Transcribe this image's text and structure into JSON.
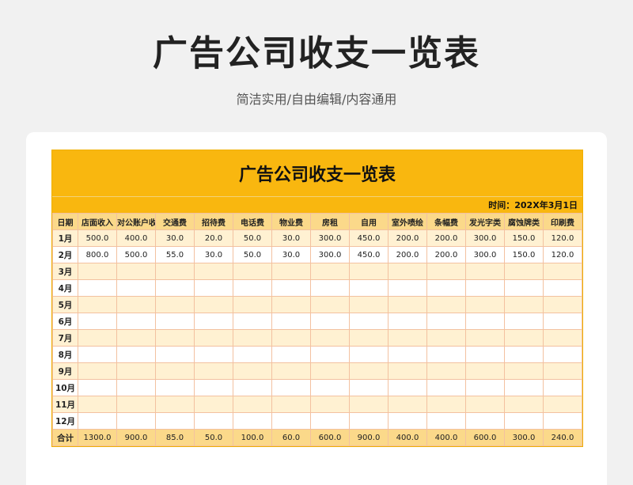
{
  "header": {
    "title": "广告公司收支一览表",
    "subtitle": "简洁实用/自由编辑/内容通用"
  },
  "sheet": {
    "title": "广告公司收支一览表",
    "date_label": "时间：202X年3月1日",
    "columns": [
      "日期",
      "店面收入",
      "对公账户收入",
      "交通费",
      "招待费",
      "电话费",
      "物业费",
      "房租",
      "自用",
      "室外喷绘",
      "条幅费",
      "发光字类",
      "腐蚀牌类",
      "印刷费"
    ],
    "rows": [
      [
        "1月",
        "500.0",
        "400.0",
        "30.0",
        "20.0",
        "50.0",
        "30.0",
        "300.0",
        "450.0",
        "200.0",
        "200.0",
        "300.0",
        "150.0",
        "120.0"
      ],
      [
        "2月",
        "800.0",
        "500.0",
        "55.0",
        "30.0",
        "50.0",
        "30.0",
        "300.0",
        "450.0",
        "200.0",
        "200.0",
        "300.0",
        "150.0",
        "120.0"
      ],
      [
        "3月",
        "",
        "",
        "",
        "",
        "",
        "",
        "",
        "",
        "",
        "",
        "",
        "",
        ""
      ],
      [
        "4月",
        "",
        "",
        "",
        "",
        "",
        "",
        "",
        "",
        "",
        "",
        "",
        "",
        ""
      ],
      [
        "5月",
        "",
        "",
        "",
        "",
        "",
        "",
        "",
        "",
        "",
        "",
        "",
        "",
        ""
      ],
      [
        "6月",
        "",
        "",
        "",
        "",
        "",
        "",
        "",
        "",
        "",
        "",
        "",
        "",
        ""
      ],
      [
        "7月",
        "",
        "",
        "",
        "",
        "",
        "",
        "",
        "",
        "",
        "",
        "",
        "",
        ""
      ],
      [
        "8月",
        "",
        "",
        "",
        "",
        "",
        "",
        "",
        "",
        "",
        "",
        "",
        "",
        ""
      ],
      [
        "9月",
        "",
        "",
        "",
        "",
        "",
        "",
        "",
        "",
        "",
        "",
        "",
        "",
        ""
      ],
      [
        "10月",
        "",
        "",
        "",
        "",
        "",
        "",
        "",
        "",
        "",
        "",
        "",
        "",
        ""
      ],
      [
        "11月",
        "",
        "",
        "",
        "",
        "",
        "",
        "",
        "",
        "",
        "",
        "",
        "",
        ""
      ],
      [
        "12月",
        "",
        "",
        "",
        "",
        "",
        "",
        "",
        "",
        "",
        "",
        "",
        "",
        ""
      ]
    ],
    "total": [
      "合计",
      "1300.0",
      "900.0",
      "85.0",
      "50.0",
      "100.0",
      "60.0",
      "600.0",
      "900.0",
      "400.0",
      "400.0",
      "600.0",
      "300.0",
      "240.0"
    ]
  },
  "colors": {
    "accent": "#f9b70f",
    "header_row": "#fbd98a",
    "stripe": "#fff1d2"
  }
}
